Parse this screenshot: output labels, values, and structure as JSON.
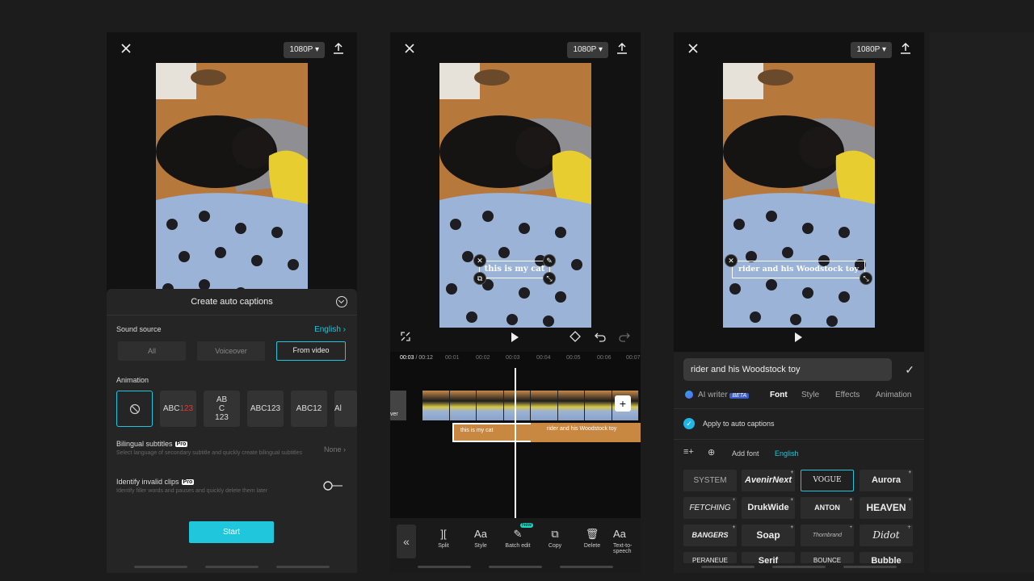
{
  "panel1": {
    "resolution": "1080P",
    "sheet_title": "Create auto captions",
    "sound_source_label": "Sound source",
    "sound_language": "English",
    "source_options": [
      "All",
      "Voiceover",
      "From video"
    ],
    "selected_source": "From video",
    "animation_label": "Animation",
    "animation_tiles": [
      "ABC",
      "123",
      "AB",
      "C",
      "123",
      "ABC123",
      "ABC12",
      "Al"
    ],
    "bilingual_label": "Bilingual subtitles",
    "bilingual_desc": "Select language of secondary subtitle and quickly create bilingual subtitles",
    "bilingual_value": "None",
    "invalid_label": "Identify invalid clips",
    "invalid_desc": "Identify filler words and pauses and quickly delete them later",
    "pro": "Pro",
    "start_label": "Start"
  },
  "panel2": {
    "resolution": "1080P",
    "caption": "this is my cat",
    "current_time": "00:03",
    "total_time": "/ 00:12",
    "ticks": [
      "00:01",
      "00:02",
      "00:03",
      "00:04",
      "00:05",
      "00:06",
      "00:07"
    ],
    "cover_label": "ver",
    "clip1": "this is my cat",
    "clip2": "rider and his Woodstock toy",
    "new_badge": "New",
    "tools": [
      "Split",
      "Style",
      "Batch edit",
      "Copy",
      "Delete",
      "Text-to-speech"
    ],
    "tool_glyphs": [
      "][",
      "Aa",
      "✎",
      "⧉",
      "🗑",
      "Aa"
    ]
  },
  "panel3": {
    "resolution": "1080P",
    "caption": "rider and his Woodstock toy",
    "input_value": "rider and his Woodstock toy",
    "tabs": [
      "AI writer",
      "Font",
      "Style",
      "Effects",
      "Animation"
    ],
    "beta": "BETA",
    "active_tab": "Font",
    "apply_label": "Apply to auto captions",
    "add_font": "Add font",
    "language": "English",
    "fonts": [
      "SYSTEM",
      "AvenirNext",
      "VOGUE",
      "Aurora",
      "FETCHING",
      "DrukWide",
      "ANTON",
      "HEAVEN",
      "BANGERS",
      "Soap",
      "Thornbrand",
      "Didot",
      "PERANEUE",
      "Serif",
      "BOUNCE",
      "Bubble"
    ],
    "selected_font": "VOGUE"
  }
}
